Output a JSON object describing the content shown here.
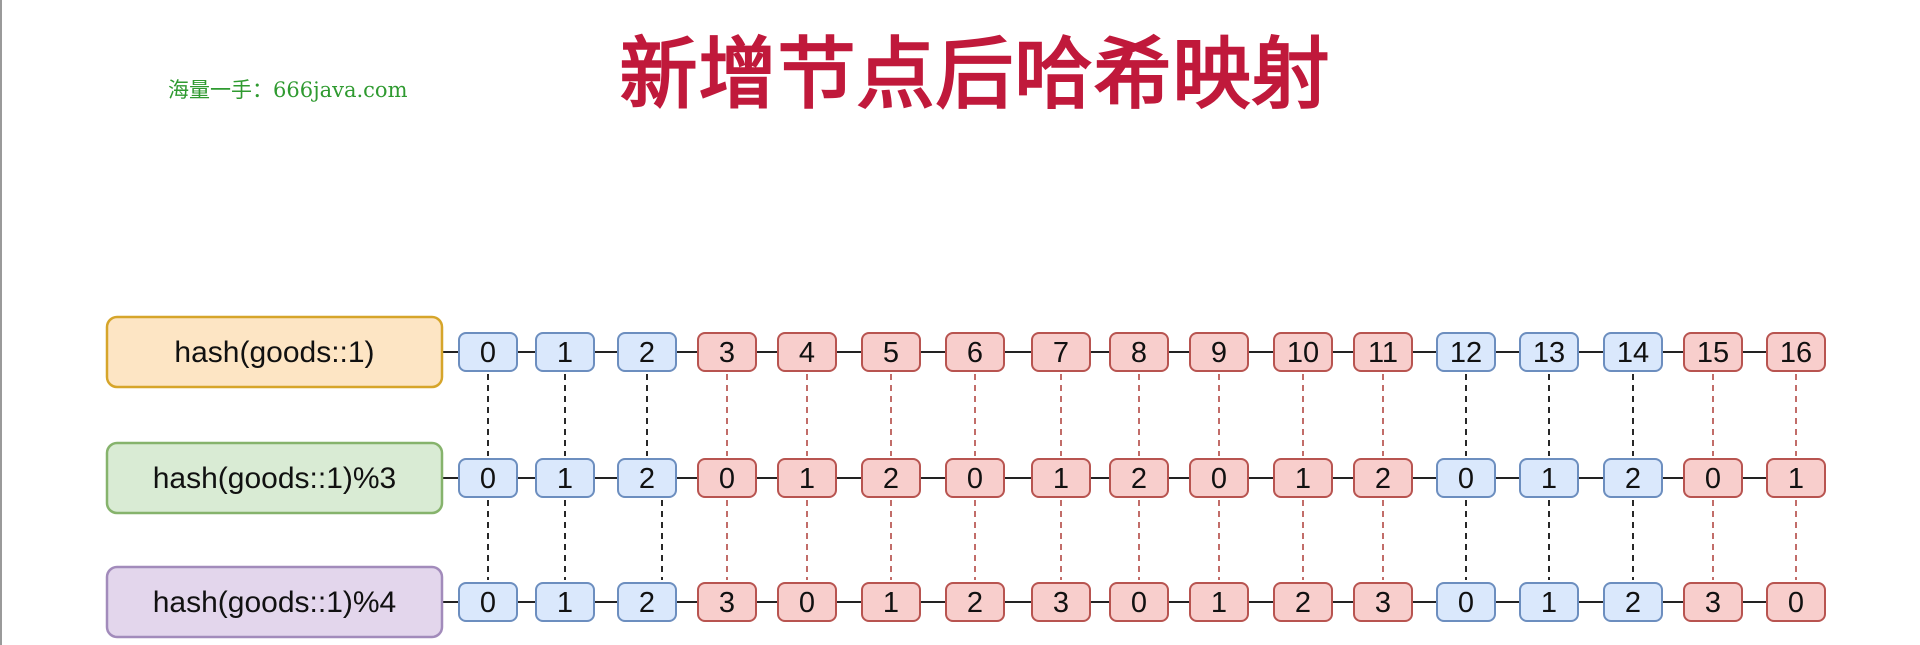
{
  "header": {
    "title": "新增节点后哈希映射",
    "watermark": "海量一手：666java.com"
  },
  "rows": [
    {
      "label": "hash(goods::1)",
      "fill": "#fde5c4",
      "stroke": "#d6a52a",
      "values": [
        "0",
        "1",
        "2",
        "3",
        "4",
        "5",
        "6",
        "7",
        "8",
        "9",
        "10",
        "11",
        "12",
        "13",
        "14",
        "15",
        "16"
      ]
    },
    {
      "label": "hash(goods::1)%3",
      "fill": "#d9ebd4",
      "stroke": "#86b36c",
      "values": [
        "0",
        "1",
        "2",
        "0",
        "1",
        "2",
        "0",
        "1",
        "2",
        "0",
        "1",
        "2",
        "0",
        "1",
        "2",
        "0",
        "1"
      ]
    },
    {
      "label": "hash(goods::1)%4",
      "fill": "#e3d6ec",
      "stroke": "#a28bbb",
      "values": [
        "0",
        "1",
        "2",
        "3",
        "0",
        "1",
        "2",
        "3",
        "0",
        "1",
        "2",
        "3",
        "0",
        "1",
        "2",
        "3",
        "0"
      ]
    }
  ],
  "cell_status": [
    "blue",
    "blue",
    "blue",
    "red",
    "red",
    "red",
    "red",
    "red",
    "red",
    "red",
    "red",
    "red",
    "blue",
    "blue",
    "blue",
    "red",
    "red"
  ],
  "colors": {
    "blue_fill": "#dae8fc",
    "blue_stroke": "#6c8ebf",
    "red_fill": "#f8cecc",
    "red_stroke": "#b85450",
    "blue_link": "#111111",
    "red_link": "#b85450",
    "title": "#c0193b",
    "watermark": "#2f9a30"
  }
}
